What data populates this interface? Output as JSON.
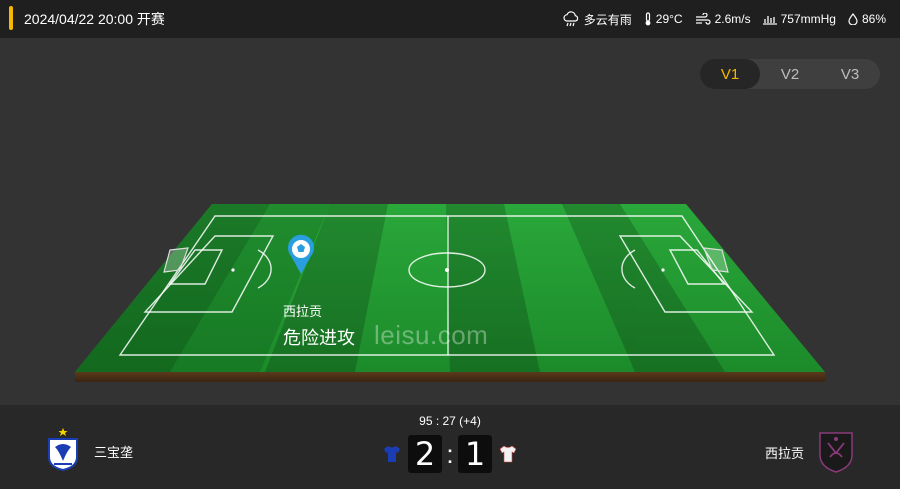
{
  "header": {
    "match_time": "2024/04/22 20:00 开赛",
    "weather": {
      "icon": "cloud-rain-icon",
      "text": "多云有雨"
    },
    "temperature": {
      "icon": "thermometer-icon",
      "text": "29°C"
    },
    "wind": {
      "icon": "wind-icon",
      "text": "2.6m/s"
    },
    "pressure": {
      "icon": "pressure-icon",
      "text": "757mmHg"
    },
    "humidity": {
      "icon": "droplet-icon",
      "text": "86%"
    }
  },
  "versions": {
    "items": [
      "V1",
      "V2",
      "V3"
    ],
    "active": "V1"
  },
  "pitch": {
    "event_team": "西拉贡",
    "event_action": "危险进攻",
    "watermark": "leisu.com",
    "marker_icon": "soccer-ball-pin-icon"
  },
  "match": {
    "clock": "95 : 27  (+4)",
    "home": {
      "name": "三宝垄",
      "score": "2",
      "shirt_color": "#1a3db3"
    },
    "away": {
      "name": "西拉贡",
      "score": "1",
      "shirt_color": "#f2f2f2"
    },
    "colon": ":"
  },
  "colors": {
    "accent": "#f5b800",
    "pitch_green": "#22992f",
    "bar_bg": "#1f1f1f"
  }
}
